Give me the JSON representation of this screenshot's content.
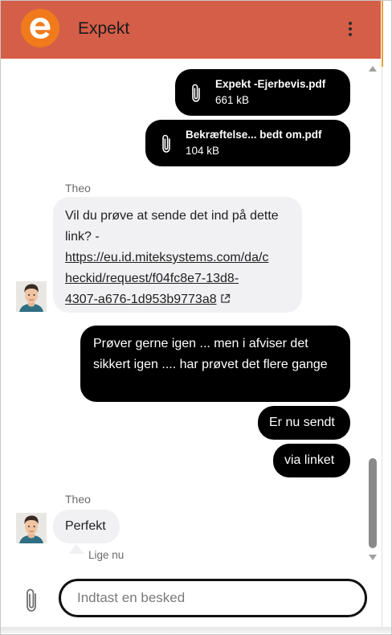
{
  "header": {
    "title": "Expekt",
    "logo_letter": "e",
    "background_color": "#d55e49",
    "logo_color": "#f07a1c",
    "menu_icon": "vertical-dots-icon"
  },
  "messages": {
    "files": [
      {
        "name": "Expekt -Ejerbevis.pdf",
        "size": "661 kB",
        "icon": "paperclip-icon"
      },
      {
        "name": "Bekræftelse... bedt om.pdf",
        "size": "104 kB",
        "icon": "paperclip-icon"
      }
    ],
    "agent_message_1": {
      "sender": "Theo",
      "text_before_link": "Vil du prøve at sende det ind på dette link? -",
      "link_lines": [
        "https://eu.id.miteksystems.com/da/c",
        "heckid/request/f04fc8e7-13d8-",
        "4307-a676-1d953b9773a8"
      ],
      "link_icon": "external-link-icon"
    },
    "user_messages": [
      "Prøver gerne igen ... men i afviser det sikkert igen .... har prøvet det flere gange",
      "Er nu sendt",
      "via linket"
    ],
    "agent_message_2": {
      "sender": "Theo",
      "text": "Perfekt",
      "time": "Lige nu"
    }
  },
  "composer": {
    "placeholder": "Indtast en besked",
    "value": "",
    "attach_icon": "paperclip-icon"
  },
  "colors": {
    "outgoing_bubble": "#000000",
    "incoming_bubble": "#f1f1f3"
  }
}
